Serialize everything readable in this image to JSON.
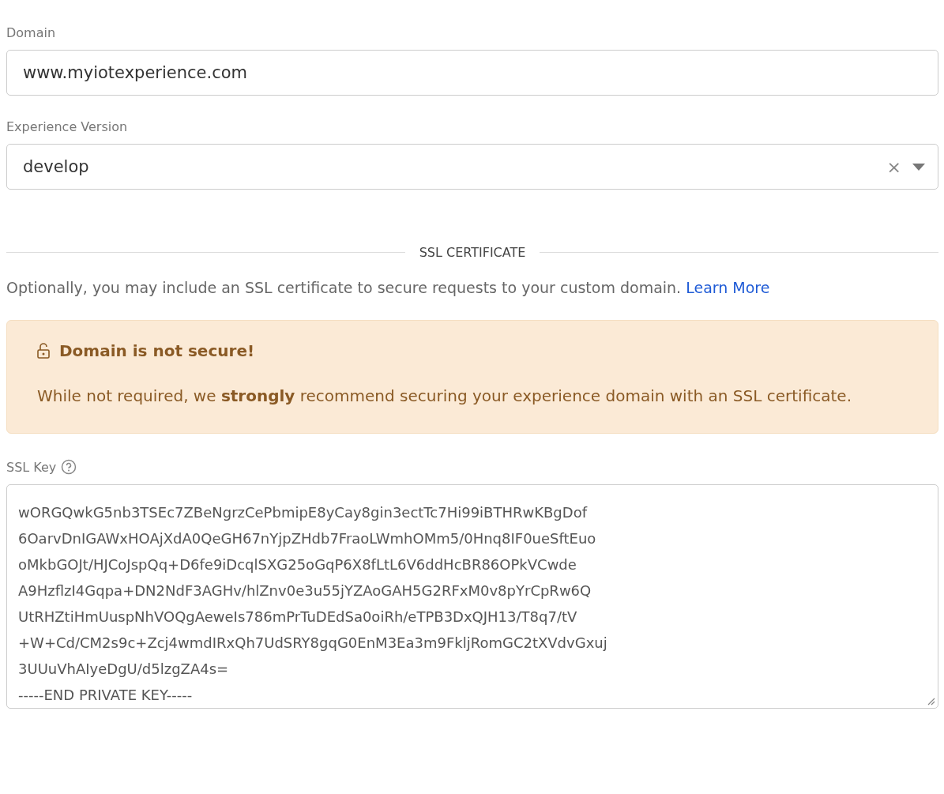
{
  "domain": {
    "label": "Domain",
    "value": "www.myiotexperience.com"
  },
  "version": {
    "label": "Experience Version",
    "value": "develop",
    "clear": "×"
  },
  "ssl_section": {
    "heading": "SSL CERTIFICATE",
    "description": "Optionally, you may include an SSL certificate to secure requests to your custom domain.",
    "link": "Learn More"
  },
  "alert": {
    "title": "Domain is not secure!",
    "body": "While not required, we **strongly** recommend securing your experience domain with an SSL certificate."
  },
  "ssl_key": {
    "label": "SSL Key",
    "lines": [
      "wORGQwkG5nb3TSEc7ZBeNgrzCePbmipE8yCay8gin3ectTc7Hi99iBTHRwKBgDof",
      "6OarvDnIGAWxHOAjXdA0QeGH67nYjpZHdb7FraoLWmhOMm5/0Hnq8IF0ueSftEuo",
      "oMkbGOJt/HJCoJspQq+D6fe9iDcqlSXG25oGqP6X8fLtL6V6ddHcBR86OPkVCwde",
      "A9HzflzI4Gqpa+DN2NdF3AGHv/hlZnv0e3u55jYZAoGAH5G2RFxM0v8pYrCpRw6Q",
      "UtRHZtiHmUuspNhVOQgAeweIs786mPrTuDEdSa0oiRh/eTPB3DxQJH13/T8q7/tV",
      "+W+Cd/CM2s9c+Zcj4wmdIRxQh7UdSRY8gqG0EnM3Ea3m9FkljRomGC2tXVdvGxuj",
      "3UUuVhAIyeDgU/d5lzgZA4s=",
      "-----END PRIVATE KEY-----"
    ]
  }
}
